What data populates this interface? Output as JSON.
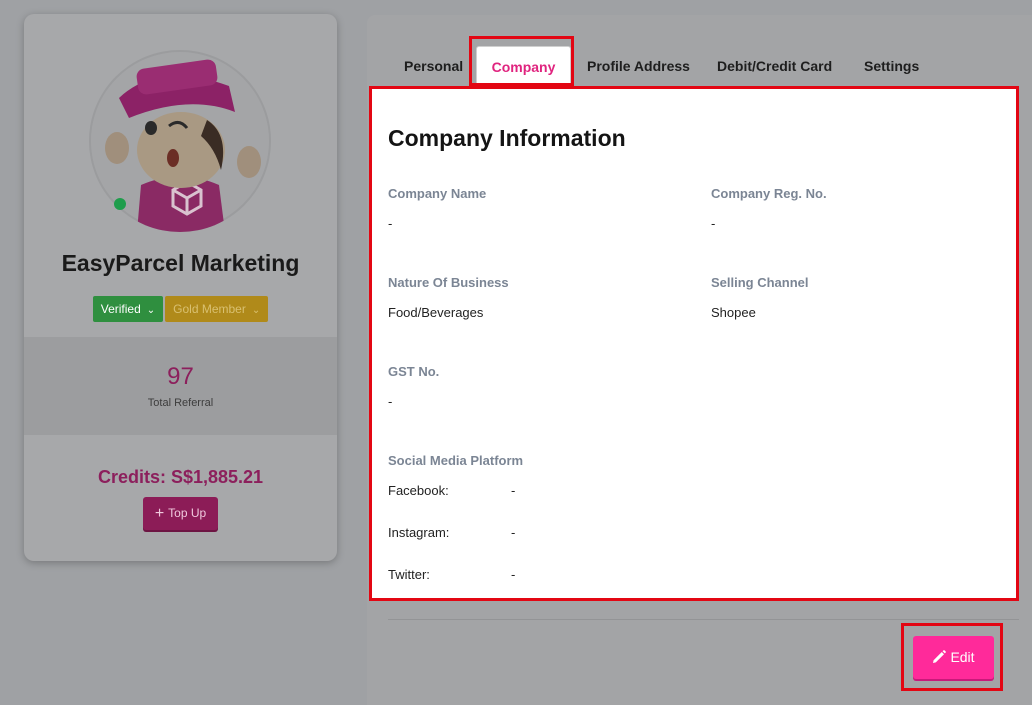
{
  "profile": {
    "name": "EasyParcel Marketing",
    "badges": {
      "verified": "Verified",
      "gold_member": "Gold Member"
    },
    "referral": {
      "count": "97",
      "label": "Total Referral"
    },
    "credits": "Credits: S$1,885.21",
    "top_up_label": "Top Up"
  },
  "tabs": [
    {
      "label": "Personal"
    },
    {
      "label": "Company"
    },
    {
      "label": "Profile Address"
    },
    {
      "label": "Debit/Credit Card"
    },
    {
      "label": "Settings"
    }
  ],
  "company_info": {
    "title": "Company Information",
    "company_name": {
      "label": "Company Name",
      "value": "-"
    },
    "company_reg_no": {
      "label": "Company Reg. No.",
      "value": "-"
    },
    "nature_of_business": {
      "label": "Nature Of Business",
      "value": "Food/Beverages"
    },
    "selling_channel": {
      "label": "Selling Channel",
      "value": "Shopee"
    },
    "gst_no": {
      "label": "GST No.",
      "value": "-"
    },
    "social_media": {
      "label": "Social Media Platform",
      "items": [
        {
          "name": "Facebook:",
          "value": "-"
        },
        {
          "name": "Instagram:",
          "value": "-"
        },
        {
          "name": "Twitter:",
          "value": "-"
        }
      ]
    }
  },
  "actions": {
    "edit_label": "Edit"
  },
  "colors": {
    "accent": "#e0247f",
    "highlight": "#e30613",
    "edit_button": "#ff2a9a"
  }
}
